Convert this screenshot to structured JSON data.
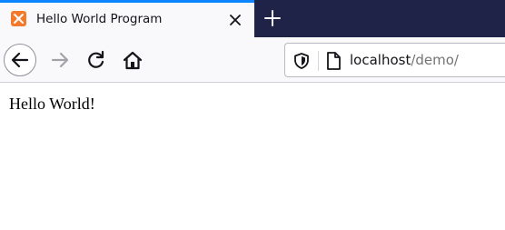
{
  "tab": {
    "title": "Hello World Program",
    "favicon": "xampp-icon",
    "close_icon": "close-icon"
  },
  "new_tab_icon": "plus-icon",
  "nav": {
    "back_icon": "arrow-left-icon",
    "forward_icon": "arrow-right-icon",
    "reload_icon": "reload-icon",
    "home_icon": "home-icon"
  },
  "urlbar": {
    "host": "localhost",
    "path": "/demo/",
    "shield_icon": "shield-icon",
    "page_icon": "page-icon"
  },
  "page": {
    "text": "Hello World!"
  },
  "colors": {
    "tabstrip_bg": "#1f2347",
    "tab_accent": "#0a84ff",
    "favicon": "#f5792a"
  }
}
